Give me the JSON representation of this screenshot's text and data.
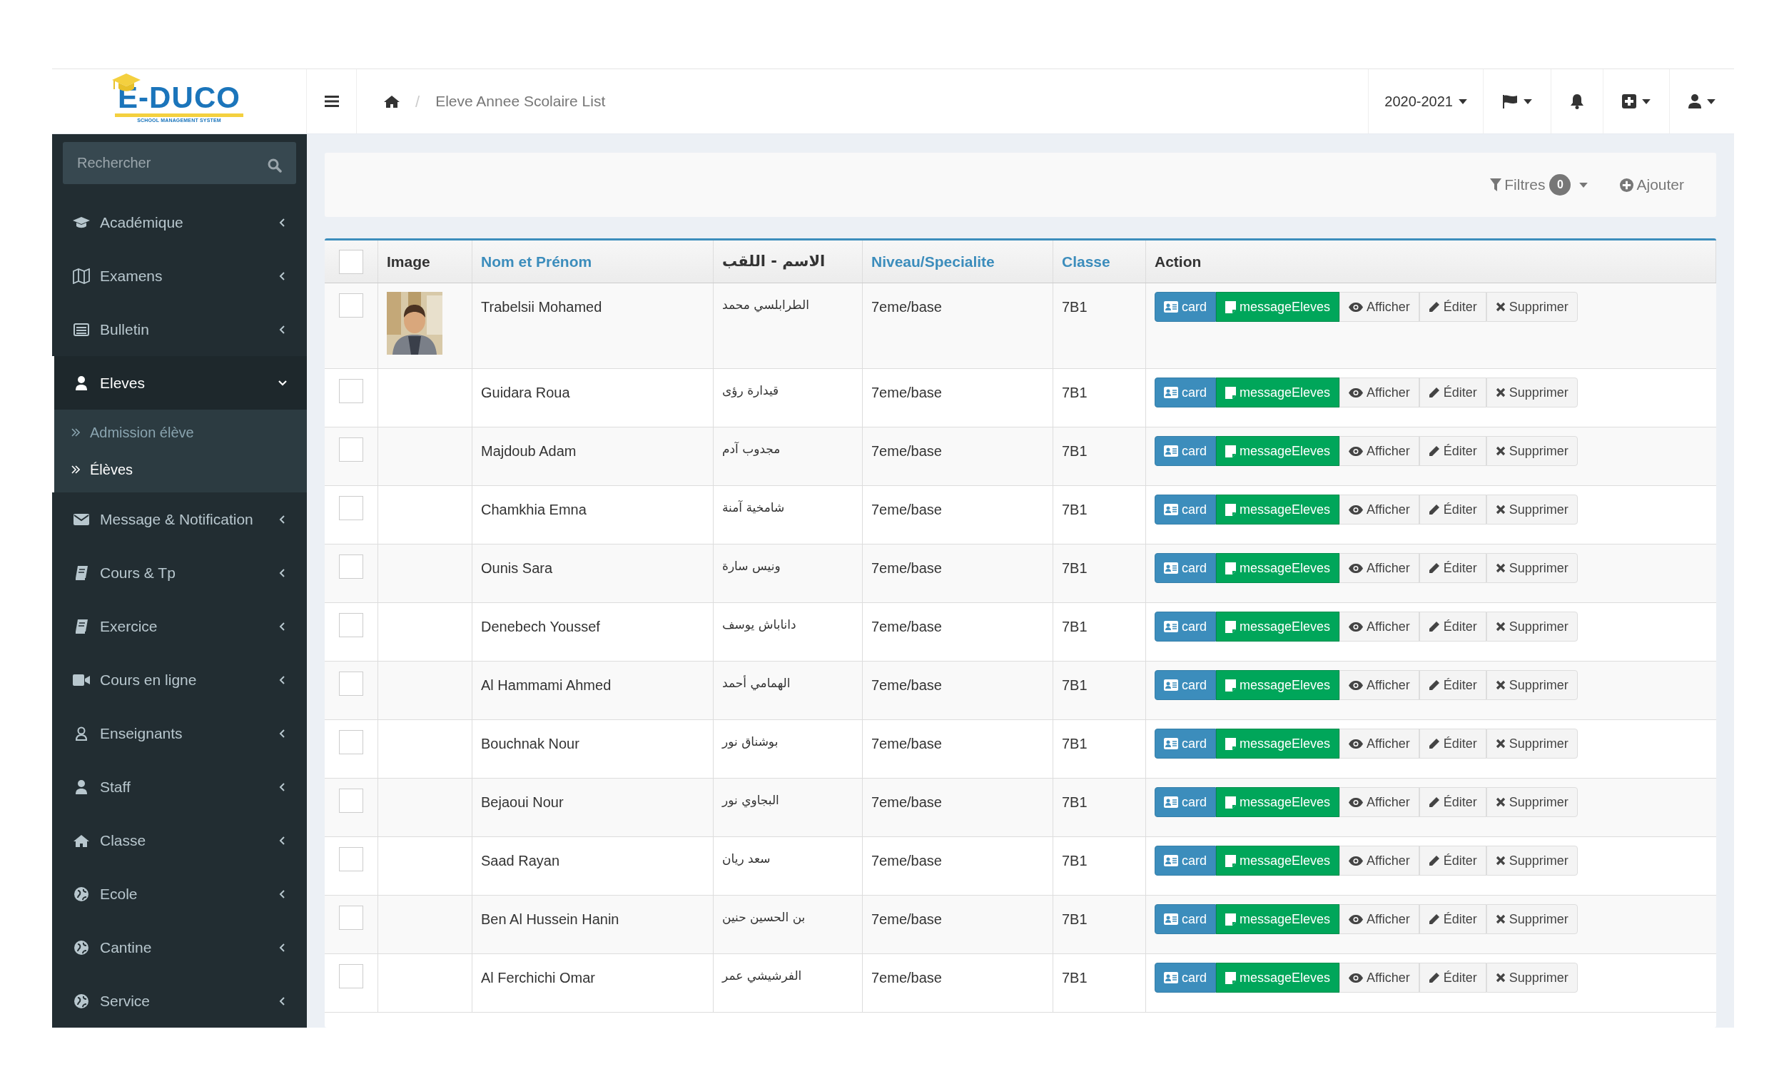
{
  "logo": {
    "name": "E-DUCO",
    "tagline": "SCHOOL MANAGEMENT SYSTEM"
  },
  "header": {
    "breadcrumb_separator": "/",
    "breadcrumb": "Eleve Annee Scolaire List",
    "year": "2020-2021"
  },
  "search": {
    "placeholder": "Rechercher"
  },
  "sidebar": {
    "items": [
      {
        "label": "Académique",
        "expanded": false
      },
      {
        "label": "Examens",
        "expanded": false
      },
      {
        "label": "Bulletin",
        "expanded": false
      },
      {
        "label": "Eleves",
        "expanded": true,
        "children": [
          {
            "label": "Admission élève",
            "selected": false
          },
          {
            "label": "Élèves",
            "selected": true
          }
        ]
      },
      {
        "label": "Message & Notification",
        "expanded": false
      },
      {
        "label": "Cours & Tp",
        "expanded": false
      },
      {
        "label": "Exercice",
        "expanded": false
      },
      {
        "label": "Cours en ligne",
        "expanded": false
      },
      {
        "label": "Enseignants",
        "expanded": false
      },
      {
        "label": "Staff",
        "expanded": false
      },
      {
        "label": "Classe",
        "expanded": false
      },
      {
        "label": "Ecole",
        "expanded": false
      },
      {
        "label": "Cantine",
        "expanded": false
      },
      {
        "label": "Service",
        "expanded": false
      }
    ]
  },
  "toolbar": {
    "filters_label": "Filtres",
    "filters_count": "0",
    "add_label": "Ajouter"
  },
  "table": {
    "select_all": {
      "checked": false
    },
    "columns": [
      {
        "label": "Image",
        "sortable": false
      },
      {
        "label": "Nom et Prénom",
        "sortable": true
      },
      {
        "label": "الاسم - اللقب",
        "sortable": false
      },
      {
        "label": "Niveau/Specialite",
        "sortable": true
      },
      {
        "label": "Classe",
        "sortable": true
      },
      {
        "label": "Action",
        "sortable": false
      }
    ],
    "rows": [
      {
        "checked": false,
        "image": {
          "kind": "picture"
        },
        "name": "Trabelsii Mohamed",
        "arabic": "الطرابلسي محمد",
        "niveau": "7eme/base",
        "classe": "7B1",
        "actions": [
          {
            "kind": "card",
            "label": "card"
          },
          {
            "kind": "message",
            "label": "messageEleves"
          },
          {
            "kind": "view",
            "label": "Afficher"
          },
          {
            "kind": "edit",
            "label": "Éditer"
          },
          {
            "kind": "delete",
            "label": "Supprimer"
          }
        ]
      },
      {
        "checked": false,
        "name": "Guidara Roua",
        "arabic": "قيدارة رؤى",
        "niveau": "7eme/base",
        "classe": "7B1",
        "actions": [
          {
            "kind": "card",
            "label": "card"
          },
          {
            "kind": "message",
            "label": "messageEleves"
          },
          {
            "kind": "view",
            "label": "Afficher"
          },
          {
            "kind": "edit",
            "label": "Éditer"
          },
          {
            "kind": "delete",
            "label": "Supprimer"
          }
        ]
      },
      {
        "checked": false,
        "name": "Majdoub Adam",
        "arabic": "مجدوب آدم",
        "niveau": "7eme/base",
        "classe": "7B1",
        "actions": [
          {
            "kind": "card",
            "label": "card"
          },
          {
            "kind": "message",
            "label": "messageEleves"
          },
          {
            "kind": "view",
            "label": "Afficher"
          },
          {
            "kind": "edit",
            "label": "Éditer"
          },
          {
            "kind": "delete",
            "label": "Supprimer"
          }
        ]
      },
      {
        "checked": false,
        "name": "Chamkhia Emna",
        "arabic": "شامخية آمنة",
        "niveau": "7eme/base",
        "classe": "7B1",
        "actions": [
          {
            "kind": "card",
            "label": "card"
          },
          {
            "kind": "message",
            "label": "messageEleves"
          },
          {
            "kind": "view",
            "label": "Afficher"
          },
          {
            "kind": "edit",
            "label": "Éditer"
          },
          {
            "kind": "delete",
            "label": "Supprimer"
          }
        ]
      },
      {
        "checked": false,
        "name": "Ounis Sara",
        "arabic": "ونيس سارة",
        "niveau": "7eme/base",
        "classe": "7B1",
        "actions": [
          {
            "kind": "card",
            "label": "card"
          },
          {
            "kind": "message",
            "label": "messageEleves"
          },
          {
            "kind": "view",
            "label": "Afficher"
          },
          {
            "kind": "edit",
            "label": "Éditer"
          },
          {
            "kind": "delete",
            "label": "Supprimer"
          }
        ]
      },
      {
        "checked": false,
        "name": "Denebech Youssef",
        "arabic": "داناباش يوسف",
        "niveau": "7eme/base",
        "classe": "7B1",
        "actions": [
          {
            "kind": "card",
            "label": "card"
          },
          {
            "kind": "message",
            "label": "messageEleves"
          },
          {
            "kind": "view",
            "label": "Afficher"
          },
          {
            "kind": "edit",
            "label": "Éditer"
          },
          {
            "kind": "delete",
            "label": "Supprimer"
          }
        ]
      },
      {
        "checked": false,
        "name": "Al Hammami Ahmed",
        "arabic": "الهمامي أحمد",
        "niveau": "7eme/base",
        "classe": "7B1",
        "actions": [
          {
            "kind": "card",
            "label": "card"
          },
          {
            "kind": "message",
            "label": "messageEleves"
          },
          {
            "kind": "view",
            "label": "Afficher"
          },
          {
            "kind": "edit",
            "label": "Éditer"
          },
          {
            "kind": "delete",
            "label": "Supprimer"
          }
        ]
      },
      {
        "checked": false,
        "name": "Bouchnak Nour",
        "arabic": "بوشناق نور",
        "niveau": "7eme/base",
        "classe": "7B1",
        "actions": [
          {
            "kind": "card",
            "label": "card"
          },
          {
            "kind": "message",
            "label": "messageEleves"
          },
          {
            "kind": "view",
            "label": "Afficher"
          },
          {
            "kind": "edit",
            "label": "Éditer"
          },
          {
            "kind": "delete",
            "label": "Supprimer"
          }
        ]
      },
      {
        "checked": false,
        "name": "Bejaoui Nour",
        "arabic": "البجاوي نور",
        "niveau": "7eme/base",
        "classe": "7B1",
        "actions": [
          {
            "kind": "card",
            "label": "card"
          },
          {
            "kind": "message",
            "label": "messageEleves"
          },
          {
            "kind": "view",
            "label": "Afficher"
          },
          {
            "kind": "edit",
            "label": "Éditer"
          },
          {
            "kind": "delete",
            "label": "Supprimer"
          }
        ]
      },
      {
        "checked": false,
        "name": "Saad Rayan",
        "arabic": "سعد ريان",
        "niveau": "7eme/base",
        "classe": "7B1",
        "actions": [
          {
            "kind": "card",
            "label": "card"
          },
          {
            "kind": "message",
            "label": "messageEleves"
          },
          {
            "kind": "view",
            "label": "Afficher"
          },
          {
            "kind": "edit",
            "label": "Éditer"
          },
          {
            "kind": "delete",
            "label": "Supprimer"
          }
        ]
      },
      {
        "checked": false,
        "name": "Ben Al Hussein Hanin",
        "arabic": "بن الحسين حنين",
        "niveau": "7eme/base",
        "classe": "7B1",
        "actions": [
          {
            "kind": "card",
            "label": "card"
          },
          {
            "kind": "message",
            "label": "messageEleves"
          },
          {
            "kind": "view",
            "label": "Afficher"
          },
          {
            "kind": "edit",
            "label": "Éditer"
          },
          {
            "kind": "delete",
            "label": "Supprimer"
          }
        ]
      },
      {
        "checked": false,
        "name": "Al Ferchichi Omar",
        "arabic": "الفرشيشي عمر",
        "niveau": "7eme/base",
        "classe": "7B1",
        "actions": [
          {
            "kind": "card",
            "label": "card"
          },
          {
            "kind": "message",
            "label": "messageEleves"
          },
          {
            "kind": "view",
            "label": "Afficher"
          },
          {
            "kind": "edit",
            "label": "Éditer"
          },
          {
            "kind": "delete",
            "label": "Supprimer"
          }
        ]
      }
    ]
  }
}
